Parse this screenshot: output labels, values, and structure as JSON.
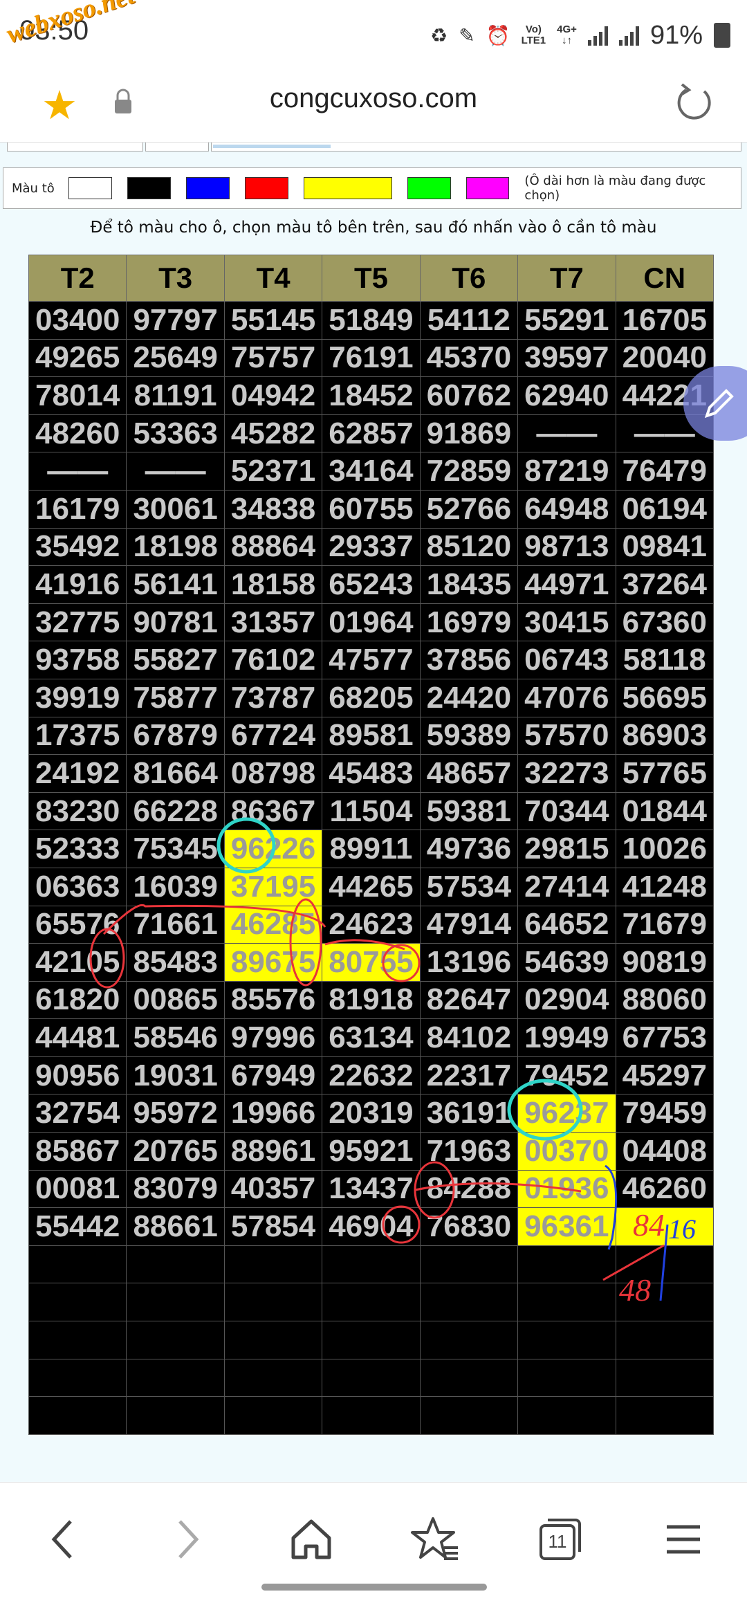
{
  "status_bar": {
    "time": "03:50",
    "network_top": "Vo)",
    "network_bottom": "LTE1",
    "net_type": "4G+",
    "battery": "91%"
  },
  "watermark": "webxoso.net",
  "browser": {
    "url": "congcuxoso.com"
  },
  "palette": {
    "label": "Màu tô",
    "hint": "(Ô dài hơn là màu đang được chọn)",
    "colors": [
      "#ffffff",
      "#000000",
      "#0000ff",
      "#ff0000",
      "#ffff00",
      "#00ff00",
      "#ff00ff"
    ]
  },
  "instruction": "Để tô màu cho ô, chọn màu tô bên trên, sau đó nhấn vào ô cần tô màu",
  "table": {
    "headers": [
      "T2",
      "T3",
      "T4",
      "T5",
      "T6",
      "T7",
      "CN"
    ],
    "rows": [
      [
        "03400",
        "97797",
        "55145",
        "51849",
        "54112",
        "55291",
        "16705"
      ],
      [
        "49265",
        "25649",
        "75757",
        "76191",
        "45370",
        "39597",
        "20040"
      ],
      [
        "78014",
        "81191",
        "04942",
        "18452",
        "60762",
        "62940",
        "44221"
      ],
      [
        "48260",
        "53363",
        "45282",
        "62857",
        "91869",
        "——",
        "——"
      ],
      [
        "——",
        "——",
        "52371",
        "34164",
        "72859",
        "87219",
        "76479"
      ],
      [
        "16179",
        "30061",
        "34838",
        "60755",
        "52766",
        "64948",
        "06194"
      ],
      [
        "35492",
        "18198",
        "88864",
        "29337",
        "85120",
        "98713",
        "09841"
      ],
      [
        "41916",
        "56141",
        "18158",
        "65243",
        "18435",
        "44971",
        "37264"
      ],
      [
        "32775",
        "90781",
        "31357",
        "01964",
        "16979",
        "30415",
        "67360"
      ],
      [
        "93758",
        "55827",
        "76102",
        "47577",
        "37856",
        "06743",
        "58118"
      ],
      [
        "39919",
        "75877",
        "73787",
        "68205",
        "24420",
        "47076",
        "56695"
      ],
      [
        "17375",
        "67879",
        "67724",
        "89581",
        "59389",
        "57570",
        "86903"
      ],
      [
        "24192",
        "81664",
        "08798",
        "45483",
        "48657",
        "32273",
        "57765"
      ],
      [
        "83230",
        "66228",
        "86367",
        "11504",
        "59381",
        "70344",
        "01844"
      ],
      [
        "52333",
        "75345",
        "96226",
        "89911",
        "49736",
        "29815",
        "10026"
      ],
      [
        "06363",
        "16039",
        "37195",
        "44265",
        "57534",
        "27414",
        "41248"
      ],
      [
        "65576",
        "71661",
        "46285",
        "24623",
        "47914",
        "64652",
        "71679"
      ],
      [
        "42105",
        "85483",
        "89675",
        "80755",
        "13196",
        "54639",
        "90819"
      ],
      [
        "61820",
        "00865",
        "85576",
        "81918",
        "82647",
        "02904",
        "88060"
      ],
      [
        "44481",
        "58546",
        "97996",
        "63134",
        "84102",
        "19949",
        "67753"
      ],
      [
        "90956",
        "19031",
        "67949",
        "22632",
        "22317",
        "79452",
        "45297"
      ],
      [
        "32754",
        "95972",
        "19966",
        "20319",
        "36191",
        "96237",
        "79459"
      ],
      [
        "85867",
        "20765",
        "88961",
        "95921",
        "71963",
        "00370",
        "04408"
      ],
      [
        "00081",
        "83079",
        "40357",
        "13437",
        "84288",
        "01936",
        "46260"
      ],
      [
        "55442",
        "88661",
        "57854",
        "46904",
        "76830",
        "96361",
        ""
      ],
      [
        "",
        "",
        "",
        "",
        "",
        "",
        ""
      ],
      [
        "",
        "",
        "",
        "",
        "",
        "",
        ""
      ],
      [
        "",
        "",
        "",
        "",
        "",
        "",
        ""
      ],
      [
        "",
        "",
        "",
        "",
        "",
        "",
        ""
      ],
      [
        "",
        "",
        "",
        "",
        "",
        "",
        ""
      ]
    ],
    "highlighted": [
      [
        14,
        2
      ],
      [
        15,
        2
      ],
      [
        16,
        2
      ],
      [
        17,
        2
      ],
      [
        17,
        3
      ],
      [
        21,
        5
      ],
      [
        22,
        5
      ],
      [
        23,
        5
      ],
      [
        24,
        5
      ],
      [
        24,
        6
      ]
    ]
  },
  "annotations": {
    "note_a": "84",
    "note_b": "48",
    "note_c": "16"
  },
  "bottom_nav": {
    "tab_count": "11"
  }
}
